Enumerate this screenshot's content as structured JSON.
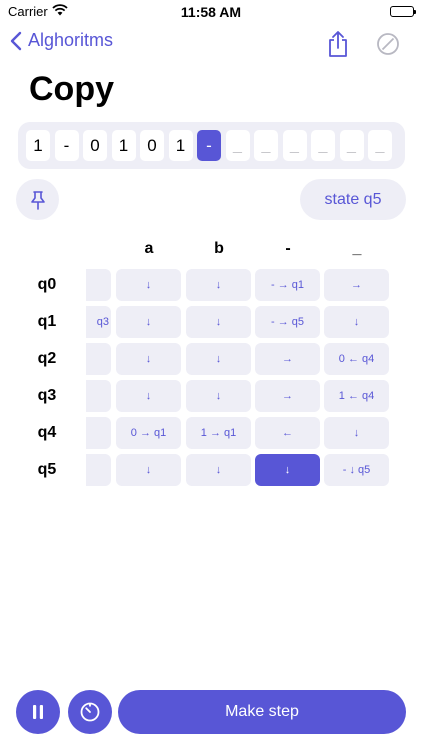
{
  "status_bar": {
    "carrier": "Carrier",
    "time": "11:58 AM"
  },
  "nav": {
    "back_label": "Alghoritms"
  },
  "title": "Copy",
  "tape": [
    "1",
    "-",
    "0",
    "1",
    "0",
    "1",
    "-",
    "_",
    "_",
    "_",
    "_",
    "_",
    "_"
  ],
  "tape_active_index": 6,
  "state_label": "state q5",
  "columns": [
    "a",
    "b",
    "-",
    "_"
  ],
  "rows": [
    {
      "state": "q0",
      "partial": "",
      "cells": [
        "↓",
        "↓",
        "- → q1",
        "→"
      ]
    },
    {
      "state": "q1",
      "partial": "q3",
      "cells": [
        "↓",
        "↓",
        "- → q5",
        "↓"
      ]
    },
    {
      "state": "q2",
      "partial": "",
      "cells": [
        "↓",
        "↓",
        "→",
        "0 ← q4"
      ]
    },
    {
      "state": "q3",
      "partial": "",
      "cells": [
        "↓",
        "↓",
        "→",
        "1 ← q4"
      ]
    },
    {
      "state": "q4",
      "partial": "",
      "cells": [
        "0 → q1",
        "1 → q1",
        "←",
        "↓"
      ]
    },
    {
      "state": "q5",
      "partial": "",
      "cells": [
        "↓",
        "↓",
        "↓",
        "- ↓ q5"
      ]
    }
  ],
  "highlight": {
    "row": 5,
    "col": 2
  },
  "step_button": "Make step",
  "colors": {
    "accent": "#5856d6",
    "cell_bg": "#eeeef6"
  },
  "icons": {
    "back": "chevron-left-icon",
    "share": "share-icon",
    "clear": "slash-circle-icon",
    "pin": "pin-icon",
    "pause": "pause-icon",
    "timer": "timer-icon"
  }
}
